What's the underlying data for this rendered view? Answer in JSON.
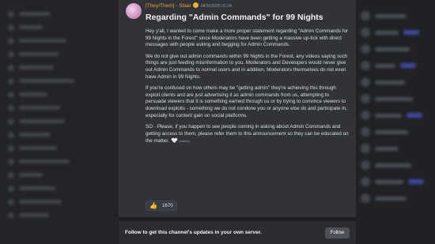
{
  "message": {
    "pronouns": "[They/Them]",
    "separator": " - ",
    "author": "Staar",
    "author_badge_icon": "crown-badge-icon",
    "timestamp": "04/10/2025 01:24",
    "title": "Regarding \"Admin Commands\" for 99 Nights",
    "paragraphs": [
      "Hey y'all, I wanted to come make a more proper statement regarding \"Admin Commands for 99 Nights in the Forest\" since Moderators have been getting a massive up-tick with direct messages with people asking and begging for Admin Commands.",
      "We do not give out admin commands within 99 Nights in the Forest, any videos saying such things are just feeding misinformation to you. Moderators and Developers would never give out Admin Commands to normal users and in addition, Moderators themselves do not even have Admin in 99 Nights.",
      "If you're confused on how others may be \"getting admin\" they're achieving this through exploit clients and are just advertising it as admin commands from us, attempting to persuade viewers that it is something earned through us or by trying to convince viewers to download exploits - something we do not condone you or anyone else do and participate in, especially for content gain on social platforms."
    ],
    "last_paragraph": "SO - Please, if you happen to see people coming in asking about Admin Commands and getting access to them, please refer them to this announcement so they can be educated on the matter.",
    "last_emoji": "heart-hands-emoji",
    "edited_label": "(edited)",
    "reaction": {
      "icon": "thumbs-up-emoji",
      "count": "1670"
    }
  },
  "follow_bar": {
    "text": "Follow to get this channel's updates in your own server.",
    "button_label": "Follow"
  },
  "colors": {
    "card_bg": "#313338",
    "author_orange": "#f0a232",
    "button_bg": "#4e5058"
  }
}
